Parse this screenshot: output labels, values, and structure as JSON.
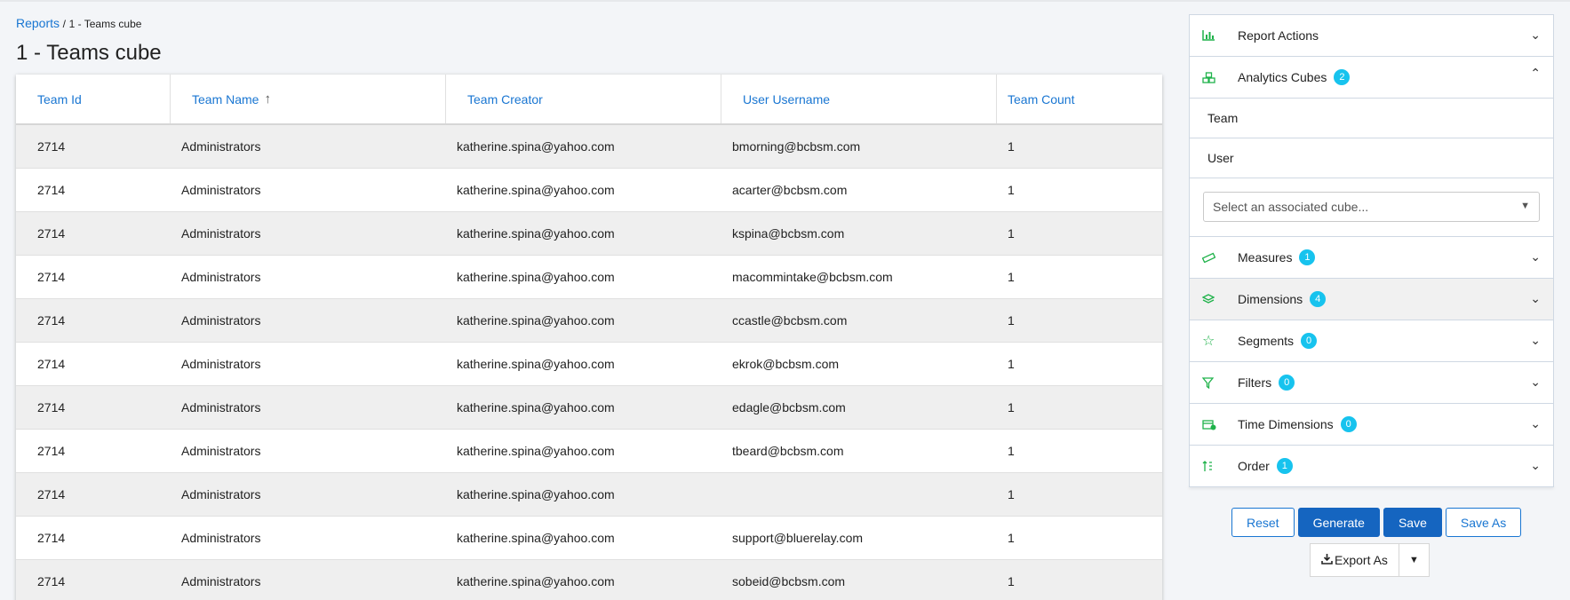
{
  "breadcrumb": {
    "link": "Reports",
    "separator": "/",
    "current": "1 - Teams cube"
  },
  "page_title": "1 - Teams cube",
  "table": {
    "headers": [
      "Team Id",
      "Team Name",
      "Team Creator",
      "User Username",
      "Team Count"
    ],
    "sort_icon": "arrow-up-icon",
    "rows": [
      [
        "2714",
        "Administrators",
        "katherine.spina@yahoo.com",
        "bmorning@bcbsm.com",
        "1"
      ],
      [
        "2714",
        "Administrators",
        "katherine.spina@yahoo.com",
        "acarter@bcbsm.com",
        "1"
      ],
      [
        "2714",
        "Administrators",
        "katherine.spina@yahoo.com",
        "kspina@bcbsm.com",
        "1"
      ],
      [
        "2714",
        "Administrators",
        "katherine.spina@yahoo.com",
        "macommintake@bcbsm.com",
        "1"
      ],
      [
        "2714",
        "Administrators",
        "katherine.spina@yahoo.com",
        "ccastle@bcbsm.com",
        "1"
      ],
      [
        "2714",
        "Administrators",
        "katherine.spina@yahoo.com",
        "ekrok@bcbsm.com",
        "1"
      ],
      [
        "2714",
        "Administrators",
        "katherine.spina@yahoo.com",
        "edagle@bcbsm.com",
        "1"
      ],
      [
        "2714",
        "Administrators",
        "katherine.spina@yahoo.com",
        "tbeard@bcbsm.com",
        "1"
      ],
      [
        "2714",
        "Administrators",
        "katherine.spina@yahoo.com",
        "",
        "1"
      ],
      [
        "2714",
        "Administrators",
        "katherine.spina@yahoo.com",
        "support@bluerelay.com",
        "1"
      ],
      [
        "2714",
        "Administrators",
        "katherine.spina@yahoo.com",
        "sobeid@bcbsm.com",
        "1"
      ]
    ]
  },
  "panel": {
    "report_actions": "Report Actions",
    "analytics_cubes": {
      "label": "Analytics Cubes",
      "count": "2",
      "items": [
        "Team",
        "User"
      ]
    },
    "cube_select_placeholder": "Select an associated cube...",
    "measures": {
      "label": "Measures",
      "count": "1"
    },
    "dimensions": {
      "label": "Dimensions",
      "count": "4"
    },
    "segments": {
      "label": "Segments",
      "count": "0"
    },
    "filters": {
      "label": "Filters",
      "count": "0"
    },
    "time_dimensions": {
      "label": "Time Dimensions",
      "count": "0"
    },
    "order": {
      "label": "Order",
      "count": "1"
    }
  },
  "buttons": {
    "reset": "Reset",
    "generate": "Generate",
    "save": "Save",
    "save_as": "Save As",
    "export_as": "Export As"
  },
  "colors": {
    "accent": "#1976d2",
    "icon_green": "#1fb24a",
    "badge": "#17c3ee"
  }
}
